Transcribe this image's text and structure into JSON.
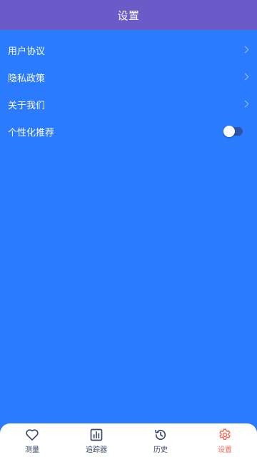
{
  "header": {
    "title": "设置"
  },
  "settings": {
    "items": [
      {
        "label": "用户协议",
        "icon": "chevron-right-icon"
      },
      {
        "label": "隐私政策",
        "icon": "chevron-right-icon"
      },
      {
        "label": "关于我们",
        "icon": "chevron-right-icon"
      },
      {
        "label": "个性化推荐",
        "toggle": false
      }
    ]
  },
  "tabbar": {
    "tabs": [
      {
        "label": "测量",
        "icon": "heart-icon",
        "active": false
      },
      {
        "label": "追踪器",
        "icon": "bar-chart-icon",
        "active": false
      },
      {
        "label": "历史",
        "icon": "history-icon",
        "active": false
      },
      {
        "label": "设置",
        "icon": "gear-icon",
        "active": true
      }
    ]
  },
  "colors": {
    "header_bg": "#6a5bc9",
    "page_bg": "#2b7bff",
    "tab_active": "#ef6b5c",
    "tab_inactive": "#3b4766"
  }
}
